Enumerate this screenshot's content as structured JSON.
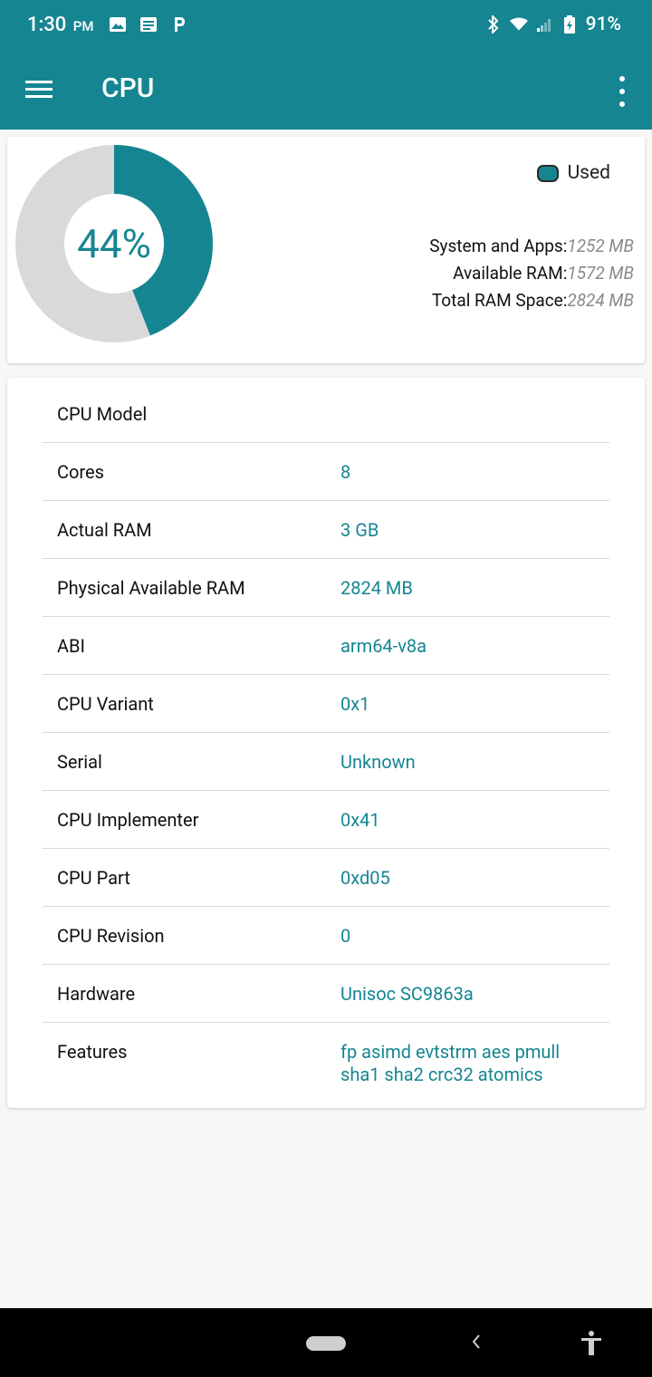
{
  "status_bar": {
    "time": "1:30",
    "ampm": "PM",
    "battery": "91%",
    "icons_left": [
      "image-icon",
      "news-icon",
      "parking-p-icon"
    ],
    "icons_right": [
      "bluetooth-icon",
      "wifi-icon",
      "signal-icon",
      "battery-icon"
    ]
  },
  "app_bar": {
    "title": "CPU",
    "nav_icon": "hamburger-menu-icon",
    "overflow_icon": "more-vertical-icon"
  },
  "ram_card": {
    "used_percent_label": "44%",
    "used_fraction": 0.44,
    "legend_label": "Used",
    "stats": [
      {
        "label": "System and Apps:",
        "value": "1252 MB"
      },
      {
        "label": "Available RAM:",
        "value": "1572 MB"
      },
      {
        "label": "Total RAM Space:",
        "value": "2824 MB"
      }
    ]
  },
  "cpu_info": [
    {
      "key": "CPU Model",
      "value": ""
    },
    {
      "key": "Cores",
      "value": "8"
    },
    {
      "key": "Actual RAM",
      "value": "3 GB"
    },
    {
      "key": "Physical Available RAM",
      "value": "2824 MB"
    },
    {
      "key": "ABI",
      "value": "arm64-v8a"
    },
    {
      "key": "CPU Variant",
      "value": "0x1"
    },
    {
      "key": "Serial",
      "value": "Unknown"
    },
    {
      "key": "CPU Implementer",
      "value": "0x41"
    },
    {
      "key": "CPU Part",
      "value": "0xd05"
    },
    {
      "key": "CPU Revision",
      "value": "0"
    },
    {
      "key": "Hardware",
      "value": "Unisoc SC9863a"
    },
    {
      "key": "Features",
      "value": "fp asimd evtstrm aes pmull sha1 sha2 crc32 atomics"
    }
  ],
  "colors": {
    "primary": "#168592",
    "donut_rest": "#d9d9d9",
    "value_text": "#168592"
  },
  "nav_bar": {
    "icons": [
      "home-pill-icon",
      "back-icon",
      "accessibility-icon"
    ]
  }
}
